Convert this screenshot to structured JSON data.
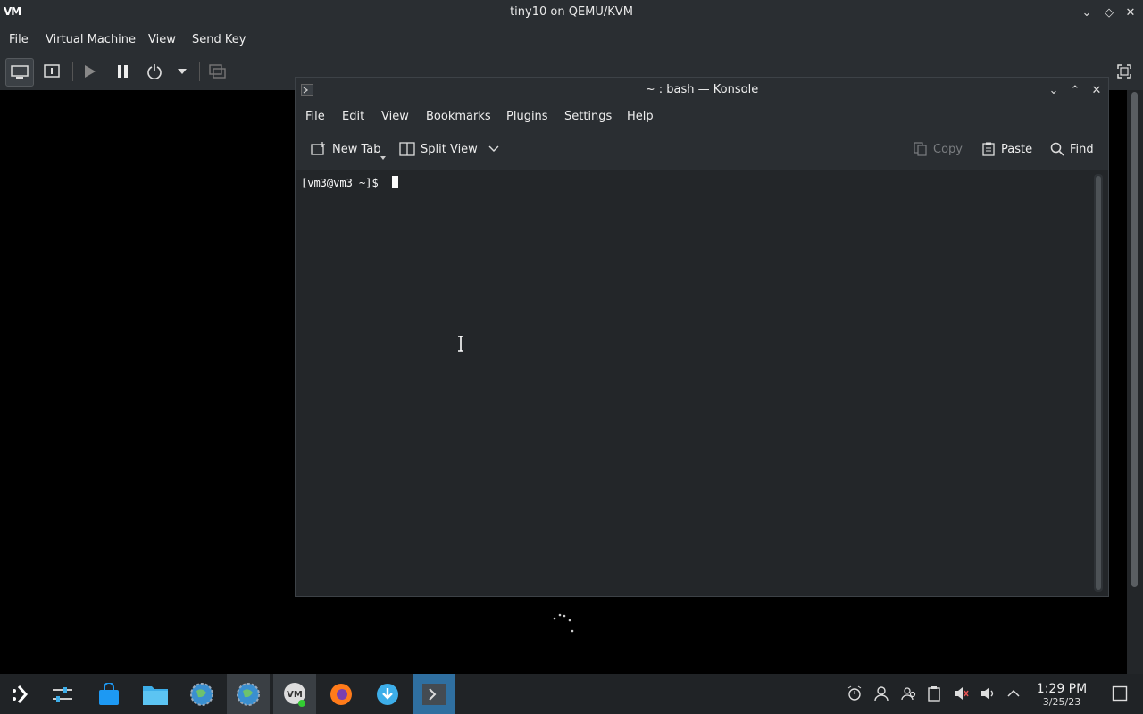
{
  "vm_window": {
    "logo": "VM",
    "title": "tiny10 on QEMU/KVM",
    "menu": [
      "File",
      "Virtual Machine",
      "View",
      "Send Key"
    ]
  },
  "konsole": {
    "title": "~ : bash — Konsole",
    "menu": [
      "File",
      "Edit",
      "View",
      "Bookmarks",
      "Plugins",
      "Settings",
      "Help"
    ],
    "toolbar": {
      "new_tab": "New Tab",
      "split_view": "Split View",
      "copy": "Copy",
      "paste": "Paste",
      "find": "Find"
    },
    "prompt": "[vm3@vm3 ~]$ "
  },
  "taskbar": {
    "clock_time": "1:29 PM",
    "clock_date": "3/25/23"
  },
  "colors": {
    "panel": "#2a2e32",
    "terminal_bg": "#232629",
    "taskbar": "#202326",
    "active_task": "#2f6fa0"
  }
}
